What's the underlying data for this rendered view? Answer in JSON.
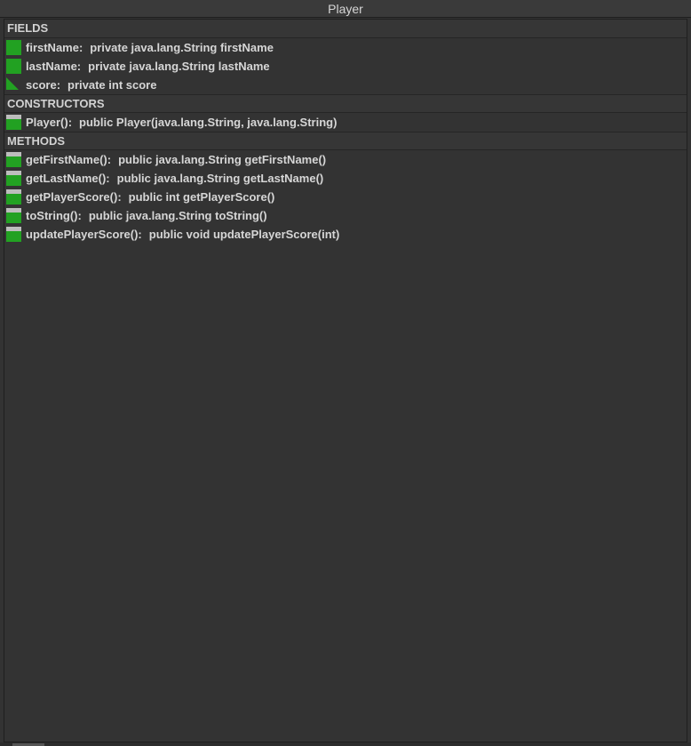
{
  "window": {
    "title": "Player"
  },
  "sections": {
    "fields": {
      "label": "FIELDS",
      "items": [
        {
          "name": "firstName():",
          "sig": "private java.lang.String firstName",
          "icon": "public-field-icon",
          "display_name": "firstName:"
        },
        {
          "name": "lastName:",
          "sig": "private java.lang.String lastName",
          "icon": "public-field-icon"
        },
        {
          "name": "score:",
          "sig": "private int score",
          "icon": "package-field-icon"
        }
      ]
    },
    "constructors": {
      "label": "CONSTRUCTORS",
      "items": [
        {
          "name": "Player():",
          "sig": "public Player(java.lang.String, java.lang.String)",
          "icon": "method-icon"
        }
      ]
    },
    "methods": {
      "label": "METHODS",
      "items": [
        {
          "name": "getFirstName():",
          "sig": "public java.lang.String getFirstName()",
          "icon": "method-icon"
        },
        {
          "name": "getLastName():",
          "sig": "public java.lang.String getLastName()",
          "icon": "method-icon"
        },
        {
          "name": "getPlayerScore():",
          "sig": "public int getPlayerScore()",
          "icon": "method-icon"
        },
        {
          "name": "toString():",
          "sig": "public java.lang.String toString()",
          "icon": "method-icon"
        },
        {
          "name": "updatePlayerScore():",
          "sig": "public void updatePlayerScore(int)",
          "icon": "method-icon"
        }
      ]
    }
  },
  "colors": {
    "background": "#333333",
    "text": "#d6d6d6",
    "icon_green": "#22a122",
    "icon_gray": "#bdbdbd"
  }
}
